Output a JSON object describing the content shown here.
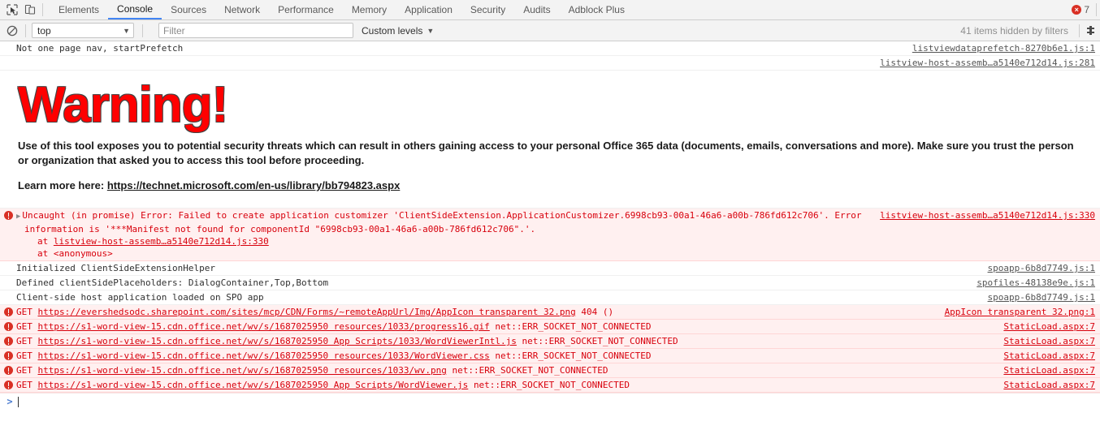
{
  "tabbar": {
    "inspect_icon": "inspect-element-icon",
    "device_icon": "device-toolbar-icon",
    "tabs": [
      {
        "label": "Elements",
        "active": false
      },
      {
        "label": "Console",
        "active": true
      },
      {
        "label": "Sources",
        "active": false
      },
      {
        "label": "Network",
        "active": false
      },
      {
        "label": "Performance",
        "active": false
      },
      {
        "label": "Memory",
        "active": false
      },
      {
        "label": "Application",
        "active": false
      },
      {
        "label": "Security",
        "active": false
      },
      {
        "label": "Audits",
        "active": false
      },
      {
        "label": "Adblock Plus",
        "active": false
      }
    ],
    "error_count": "7"
  },
  "toolbar": {
    "clear_icon": "clear-console-icon",
    "context": "top",
    "filter_placeholder": "Filter",
    "filter_value": "",
    "levels_label": "Custom levels",
    "hidden_items": "41 items hidden by filters",
    "settings_icon": "settings-gear-icon"
  },
  "messages": [
    {
      "id": "m1",
      "kind": "log",
      "text": "Not one page nav, startPrefetch",
      "source": "listviewdataprefetch-8270b6e1.js:1"
    },
    {
      "id": "m2",
      "kind": "log-source-only",
      "text": "",
      "source": "listview-host-assemb…a5140e712d14.js:281"
    },
    {
      "id": "m3",
      "kind": "html",
      "title": "Warning!",
      "paragraph": "Use of this tool exposes you to potential security threats which can result in others gaining access to your personal Office 365 data (documents, emails, conversations and more). Make sure you trust the person or organization that asked you to access this tool before proceeding.",
      "learn_prefix": "Learn more here: ",
      "learn_url": "https://technet.microsoft.com/en-us/library/bb794823.aspx"
    },
    {
      "id": "m4",
      "kind": "error-stack",
      "line1": "Uncaught (in promise) Error: Failed to create application customizer 'ClientSideExtension.ApplicationCustomizer.6998cb93-00a1-46a6-a00b-786fd612c706'. Error",
      "line2": "information is '***Manifest not found for componentId \"6998cb93-00a1-46a6-a00b-786fd612c706\".'.",
      "stack1_prefix": "at ",
      "stack1_link": "listview-host-assemb…a5140e712d14.js:330",
      "stack2": "at <anonymous>",
      "source": "listview-host-assemb…a5140e712d14.js:330"
    },
    {
      "id": "m5",
      "kind": "log",
      "text": "Initialized ClientSideExtensionHelper",
      "source": "spoapp-6b8d7749.js:1"
    },
    {
      "id": "m6",
      "kind": "log",
      "text": "Defined clientSidePlaceholders: DialogContainer,Top,Bottom",
      "source": "spofiles-48138e9e.js:1"
    },
    {
      "id": "m7",
      "kind": "log",
      "text": "Client-side host application loaded on SPO app",
      "source": "spoapp-6b8d7749.js:1"
    },
    {
      "id": "m8",
      "kind": "get",
      "method": "GET",
      "url": "https://evershedsodc.sharepoint.com/sites/mcp/CDN/Forms/~remoteAppUrl/Img/AppIcon transparent 32.png",
      "status": "404 ()",
      "source": "AppIcon transparent 32.png:1"
    },
    {
      "id": "m9",
      "kind": "get",
      "method": "GET",
      "url": "https://s1-word-view-15.cdn.office.net/wv/s/1687025950 resources/1033/progress16.gif",
      "status": "net::ERR_SOCKET_NOT_CONNECTED",
      "source": "StaticLoad.aspx:7"
    },
    {
      "id": "m10",
      "kind": "get",
      "method": "GET",
      "url": "https://s1-word-view-15.cdn.office.net/wv/s/1687025950 App Scripts/1033/WordViewerIntl.js",
      "status": "net::ERR_SOCKET_NOT_CONNECTED",
      "source": "StaticLoad.aspx:7"
    },
    {
      "id": "m11",
      "kind": "get",
      "method": "GET",
      "url": "https://s1-word-view-15.cdn.office.net/wv/s/1687025950 resources/1033/WordViewer.css",
      "status": "net::ERR_SOCKET_NOT_CONNECTED",
      "source": "StaticLoad.aspx:7"
    },
    {
      "id": "m12",
      "kind": "get",
      "method": "GET",
      "url": "https://s1-word-view-15.cdn.office.net/wv/s/1687025950 resources/1033/wv.png",
      "status": "net::ERR_SOCKET_NOT_CONNECTED",
      "source": "StaticLoad.aspx:7"
    },
    {
      "id": "m13",
      "kind": "get",
      "method": "GET",
      "url": "https://s1-word-view-15.cdn.office.net/wv/s/1687025950 App Scripts/WordViewer.js",
      "status": "net::ERR_SOCKET_NOT_CONNECTED",
      "source": "StaticLoad.aspx:7"
    }
  ],
  "prompt": {
    "arrow": ">",
    "value": ""
  },
  "colors": {
    "error_text": "#d8000c",
    "error_bg": "#fff0f0",
    "accent": "#4285f4",
    "warning_red": "#ff0000"
  }
}
